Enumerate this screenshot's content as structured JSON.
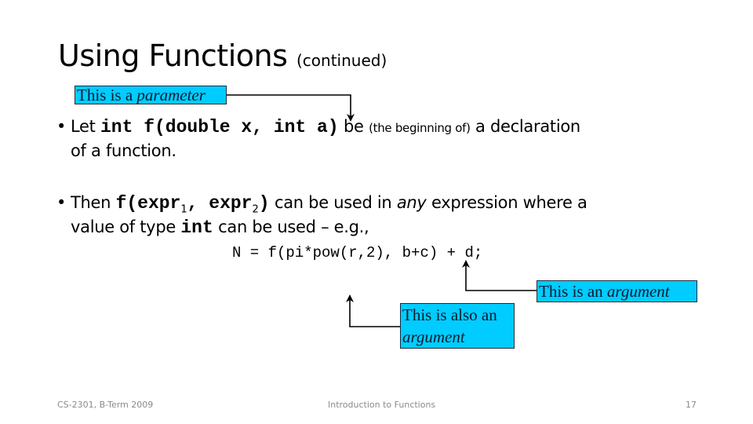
{
  "slide": {
    "title": "Using Functions",
    "title_sub": "(continued)",
    "bullet1": {
      "lead": "Let",
      "code": "int f(double x, int a)",
      "after": "be",
      "small": "(the beginning of)",
      "tail": "a declaration",
      "line2": "of a function."
    },
    "bullet2": {
      "lead": "Then",
      "code_a": "f(expr",
      "sub1": "1",
      "code_b": ", expr",
      "sub2": "2",
      "code_c": ")",
      "mid": "can be used in",
      "emph": "any",
      "tail": "expression where a",
      "line2_a": "value of type",
      "line2_code": "int",
      "line2_b": "can be used – e.g.,"
    },
    "code_example": "N = f(pi*pow(r,2), b+c) + d;",
    "callouts": {
      "parameter": {
        "text": "This is a",
        "emph": "parameter"
      },
      "argument": {
        "text": "This is an",
        "emph": "argument"
      },
      "also_argument": {
        "text": "This is also an",
        "emph": "argument"
      }
    },
    "callout_color": "#00ccff"
  },
  "footer": {
    "left": "CS-2301, B-Term 2009",
    "center": "Introduction to Functions",
    "page": "17"
  }
}
